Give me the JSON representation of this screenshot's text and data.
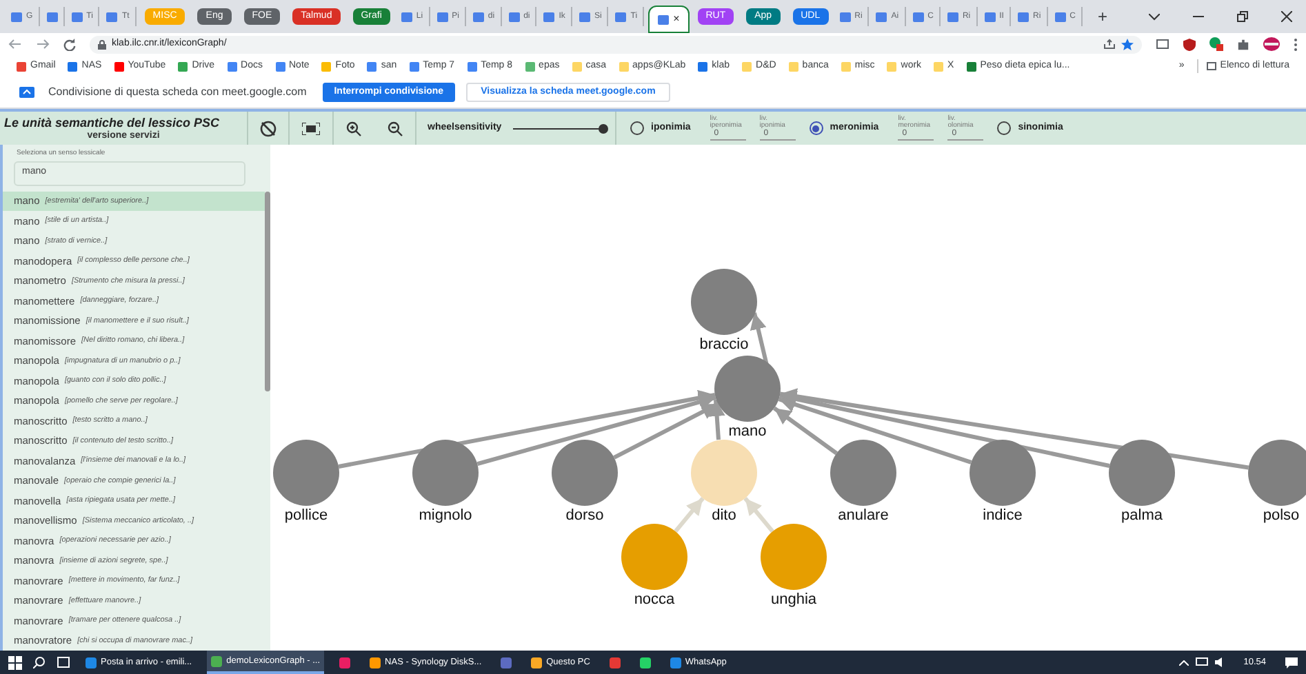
{
  "browser": {
    "tabs": [
      {
        "kind": "page",
        "label": "G",
        "selected": false
      },
      {
        "kind": "page",
        "selected": false
      },
      {
        "kind": "page",
        "label": "Ti",
        "selected": false
      },
      {
        "kind": "page",
        "label": "Tt",
        "selected": false
      },
      {
        "kind": "group",
        "label": "MISC",
        "color": "#f9ab00"
      },
      {
        "kind": "group",
        "label": "Eng",
        "color": "#5f6368"
      },
      {
        "kind": "group",
        "label": "FOE",
        "color": "#5f6368"
      },
      {
        "kind": "group",
        "label": "Talmud",
        "color": "#d93025"
      },
      {
        "kind": "group",
        "label": "Grafi",
        "color": "#188038"
      },
      {
        "kind": "page",
        "label": "Li",
        "selected": false
      },
      {
        "kind": "page",
        "label": "Pi",
        "selected": false
      },
      {
        "kind": "page",
        "label": "di",
        "selected": false
      },
      {
        "kind": "page",
        "label": "di",
        "selected": false
      },
      {
        "kind": "page",
        "label": "Ik",
        "selected": false
      },
      {
        "kind": "page",
        "label": "Si",
        "selected": false
      },
      {
        "kind": "page",
        "label": "Ti",
        "selected": false
      },
      {
        "kind": "page",
        "label": "×",
        "selected": true
      },
      {
        "kind": "group",
        "label": "RUT",
        "color": "#a142f4"
      },
      {
        "kind": "group",
        "label": "App",
        "color": "#007b83"
      },
      {
        "kind": "group",
        "label": "UDL",
        "color": "#1a73e8"
      },
      {
        "kind": "page",
        "label": "Ri",
        "selected": false
      },
      {
        "kind": "page",
        "label": "Ai",
        "selected": false
      },
      {
        "kind": "page",
        "label": "C",
        "selected": false
      },
      {
        "kind": "page",
        "label": "Ri",
        "selected": false
      },
      {
        "kind": "page",
        "label": "II",
        "selected": false
      },
      {
        "kind": "page",
        "label": "Ri",
        "selected": false
      },
      {
        "kind": "page",
        "label": "C",
        "selected": false
      }
    ],
    "new_tab": "+",
    "url": "klab.ilc.cnr.it/lexiconGraph/",
    "bookmarks": [
      "Gmail",
      "NAS",
      "YouTube",
      "Drive",
      "Docs",
      "Note",
      "Foto",
      "san",
      "Temp 7",
      "Temp 8",
      "epas",
      "casa",
      "apps@KLab",
      "klab",
      "D&D",
      "banca",
      "misc",
      "work",
      "X",
      "Peso dieta epica lu..."
    ],
    "bookmarks_more": "»",
    "reading_list": "Elenco di lettura",
    "share_bar": {
      "text": "Condivisione di questa scheda con meet.google.com",
      "stop_button": "Interrompi condivisione",
      "view_button": "Visualizza la scheda meet.google.com"
    }
  },
  "toolbar": {
    "title": "Le unità semantiche del lessico PSC",
    "subtitle": "versione servizi",
    "slider": {
      "label": "wheelsensitivity",
      "level": 1
    },
    "options": [
      {
        "kind": "radio",
        "label": "iponimia",
        "selected": false
      },
      {
        "kind": "level",
        "label": "liv.",
        "sublabel": "iperonimia",
        "value": "0"
      },
      {
        "kind": "level",
        "label": "liv.",
        "sublabel": "iponimia",
        "value": "0"
      },
      {
        "kind": "radio",
        "label": "meronimia",
        "selected": true
      },
      {
        "kind": "level",
        "label": "liv.",
        "sublabel": "meronimia",
        "value": "0"
      },
      {
        "kind": "level",
        "label": "liv.",
        "sublabel": "olonimia",
        "value": "0"
      },
      {
        "kind": "radio",
        "label": "sinonimia",
        "selected": false
      }
    ]
  },
  "sidebar": {
    "search": {
      "label": "Seleziona un senso lessicale",
      "value": "mano"
    },
    "items": [
      {
        "word": "mano",
        "gloss": "[estremita' dell'arto superiore..]",
        "selected": true
      },
      {
        "word": "mano",
        "gloss": "[stile di un artista..]",
        "selected": false
      },
      {
        "word": "mano",
        "gloss": "[strato di vernice..]",
        "selected": false
      },
      {
        "word": "manodopera",
        "gloss": "[il complesso delle persone che..]",
        "selected": false
      },
      {
        "word": "manometro",
        "gloss": "[Strumento che misura la pressi..]",
        "selected": false
      },
      {
        "word": "manomettere",
        "gloss": "[danneggiare, forzare..]",
        "selected": false
      },
      {
        "word": "manomissione",
        "gloss": "[il manomettere e il suo risult..]",
        "selected": false
      },
      {
        "word": "manomissore",
        "gloss": "[Nel diritto romano, chi libera..]",
        "selected": false
      },
      {
        "word": "manopola",
        "gloss": "[impugnatura di un manubrio o p..]",
        "selected": false
      },
      {
        "word": "manopola",
        "gloss": "[guanto con il solo dito pollic..]",
        "selected": false
      },
      {
        "word": "manopola",
        "gloss": "[pomello che serve per regolare..]",
        "selected": false
      },
      {
        "word": "manoscritto",
        "gloss": "[testo scritto a mano..]",
        "selected": false
      },
      {
        "word": "manoscritto",
        "gloss": "[il contenuto del testo scritto..]",
        "selected": false
      },
      {
        "word": "manovalanza",
        "gloss": "[l'insieme dei manovali e la lo..]",
        "selected": false
      },
      {
        "word": "manovale",
        "gloss": "[operaio che compie generici la..]",
        "selected": false
      },
      {
        "word": "manovella",
        "gloss": "[asta ripiegata usata per mette..]",
        "selected": false
      },
      {
        "word": "manovellismo",
        "gloss": "[Sistema meccanico articolato, ..]",
        "selected": false
      },
      {
        "word": "manovra",
        "gloss": "[operazioni necessarie per azio..]",
        "selected": false
      },
      {
        "word": "manovra",
        "gloss": "[insieme di azioni segrete, spe..]",
        "selected": false
      },
      {
        "word": "manovrare",
        "gloss": "[mettere in movimento, far funz..]",
        "selected": false
      },
      {
        "word": "manovrare",
        "gloss": "[effettuare manovre..]",
        "selected": false
      },
      {
        "word": "manovrare",
        "gloss": "[tramare per ottenere qualcosa ..]",
        "selected": false
      },
      {
        "word": "manovratore",
        "gloss": "[chi si occupa di manovrare mac..]",
        "selected": false
      }
    ]
  },
  "graph": {
    "center": {
      "label": "mano",
      "color": "#808080"
    },
    "holonyms": [
      {
        "label": "braccio",
        "color": "#808080"
      }
    ],
    "meronyms": [
      {
        "label": "pollice",
        "color": "#808080"
      },
      {
        "label": "mignolo",
        "color": "#808080"
      },
      {
        "label": "dorso",
        "color": "#808080"
      },
      {
        "label": "dito",
        "color": "#f7deb2",
        "children": [
          {
            "label": "nocca",
            "color": "#e69e00"
          },
          {
            "label": "unghia",
            "color": "#e69e00"
          }
        ]
      },
      {
        "label": "anulare",
        "color": "#808080"
      },
      {
        "label": "indice",
        "color": "#808080"
      },
      {
        "label": "palma",
        "color": "#808080"
      },
      {
        "label": "polso",
        "color": "#808080"
      }
    ]
  },
  "taskbar": {
    "items": [
      {
        "kind": "app",
        "label": "Posta in arrivo - emili...",
        "selected": false
      },
      {
        "kind": "app",
        "label": "demoLexiconGraph - ...",
        "selected": true
      },
      {
        "kind": "icon",
        "selected": false
      },
      {
        "kind": "app",
        "label": "NAS - Synology DiskS...",
        "selected": false
      },
      {
        "kind": "icon",
        "selected": false
      },
      {
        "kind": "app",
        "label": "Questo PC",
        "selected": false
      },
      {
        "kind": "icon",
        "selected": false
      },
      {
        "kind": "icon",
        "selected": false
      },
      {
        "kind": "app",
        "label": "WhatsApp",
        "selected": false
      }
    ],
    "clock": "10.54"
  }
}
